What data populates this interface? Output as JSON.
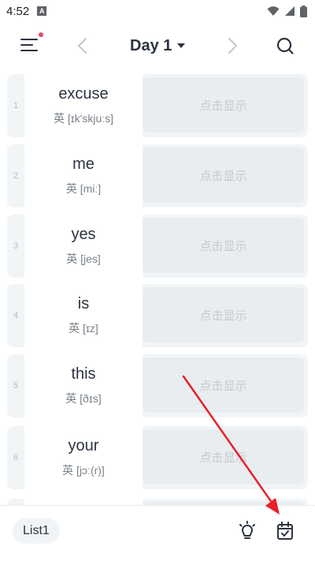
{
  "status_bar": {
    "time": "4:52",
    "notification_icon": "a-badge-icon",
    "icons": [
      "wifi-icon",
      "signal-icon",
      "battery-icon"
    ]
  },
  "header": {
    "title": "Day 1",
    "menu_icon": "menu-icon",
    "has_notification_dot": true,
    "prev_icon": "chevron-left-icon",
    "next_icon": "chevron-right-icon",
    "dropdown_icon": "caret-down-icon",
    "search_icon": "search-icon"
  },
  "words": [
    {
      "index": "1",
      "word": "excuse",
      "phonetic": "英 [ɪk'skjuːs]",
      "reveal": "点击显示"
    },
    {
      "index": "2",
      "word": "me",
      "phonetic": "英 [miː]",
      "reveal": "点击显示"
    },
    {
      "index": "3",
      "word": "yes",
      "phonetic": "英 [jes]",
      "reveal": "点击显示"
    },
    {
      "index": "4",
      "word": "is",
      "phonetic": "英 [ɪz]",
      "reveal": "点击显示"
    },
    {
      "index": "5",
      "word": "this",
      "phonetic": "英 [ðɪs]",
      "reveal": "点击显示"
    },
    {
      "index": "6",
      "word": "your",
      "phonetic": "英 [jɔː(r)]",
      "reveal": "点击显示"
    }
  ],
  "bottom_bar": {
    "list_label": "List1",
    "bulb_icon": "lightbulb-icon",
    "calendar_icon": "calendar-check-icon"
  },
  "colors": {
    "accent_dot": "#e54b6b",
    "annotation_arrow": "#e8202a",
    "text_primary": "#2c3440",
    "reveal_text": "#c4cacf"
  }
}
